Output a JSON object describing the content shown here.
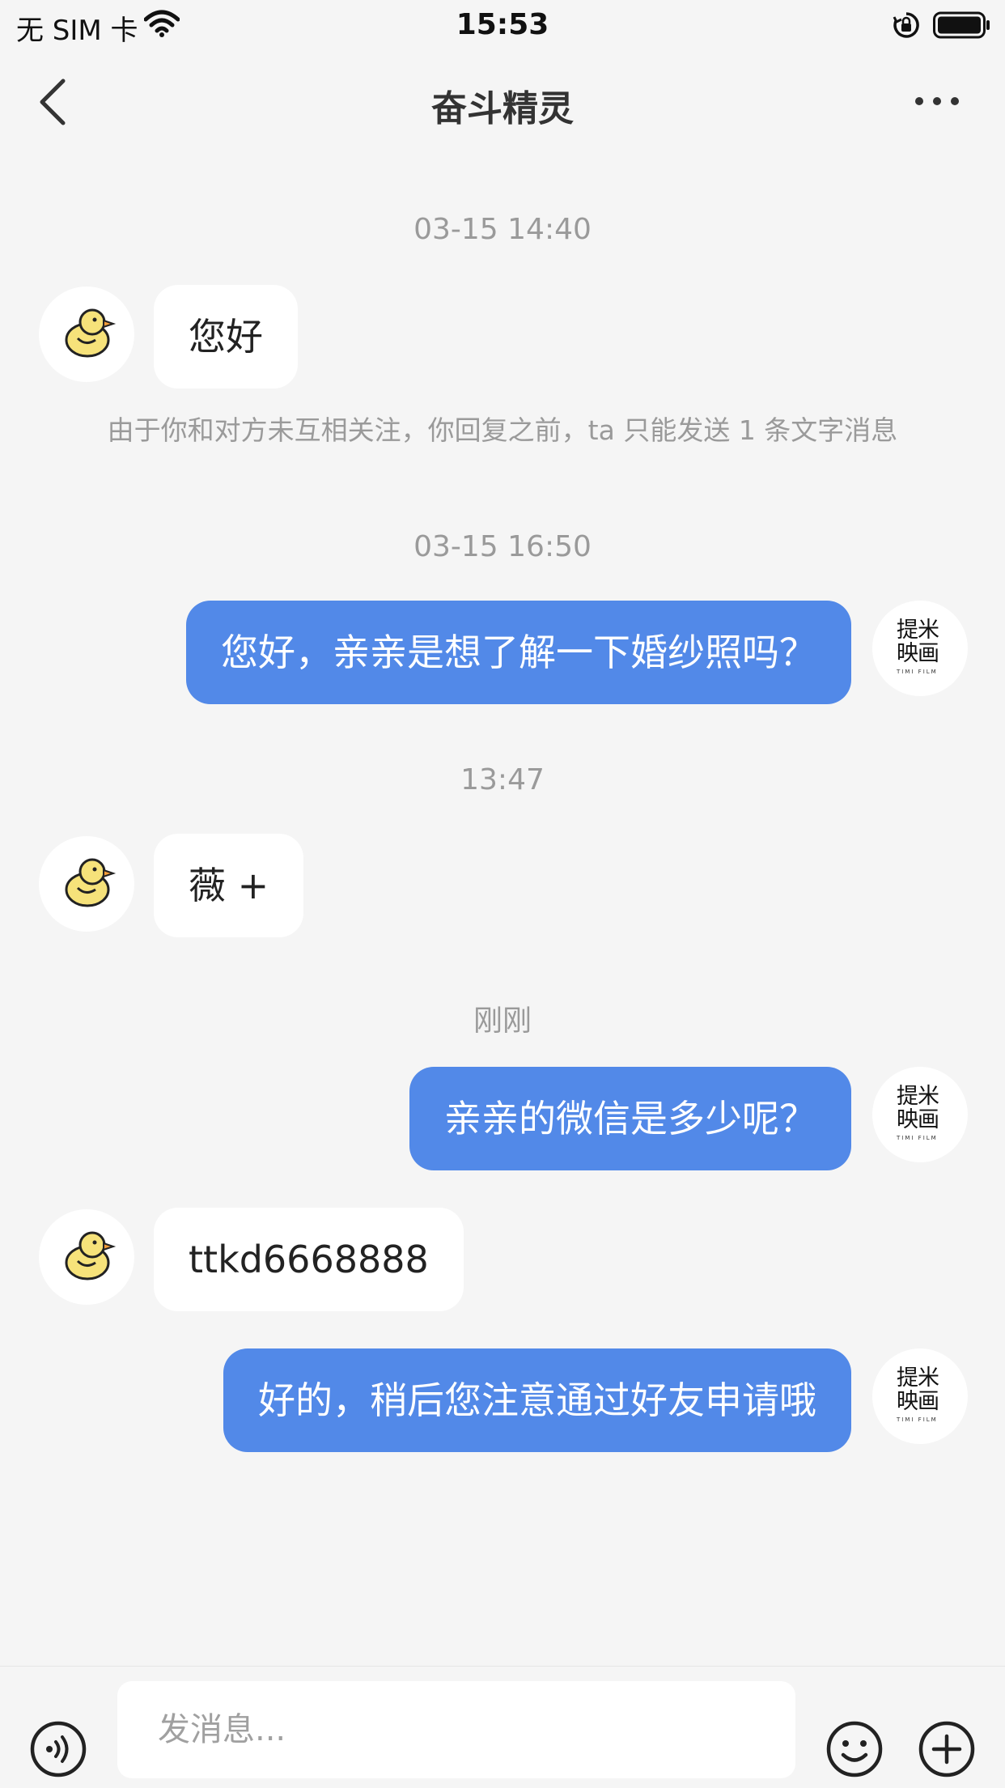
{
  "status_bar": {
    "carrier": "无 SIM 卡",
    "time": "15:53"
  },
  "header": {
    "title": "奋斗精灵"
  },
  "brand_avatar": {
    "line1": "提米",
    "line2": "映画",
    "sub": "TIMI FILM"
  },
  "conversation": [
    {
      "type": "time",
      "text": "03-15 14:40"
    },
    {
      "type": "message",
      "side": "left",
      "text": "您好"
    },
    {
      "type": "notice",
      "text": "由于你和对方未互相关注，你回复之前，ta 只能发送 1 条文字消息"
    },
    {
      "type": "time",
      "text": "03-15 16:50"
    },
    {
      "type": "message",
      "side": "right",
      "text": "您好，亲亲是想了解一下婚纱照吗？"
    },
    {
      "type": "time",
      "text": "13:47"
    },
    {
      "type": "message",
      "side": "left",
      "text": "薇 +"
    },
    {
      "type": "time",
      "text": "刚刚"
    },
    {
      "type": "message",
      "side": "right",
      "text": "亲亲的微信是多少呢？"
    },
    {
      "type": "message",
      "side": "left",
      "text": "ttkd6668888"
    },
    {
      "type": "message",
      "side": "right",
      "text": "好的，稍后您注意通过好友申请哦"
    }
  ],
  "input_bar": {
    "placeholder": "发消息..."
  },
  "icons": {
    "back": "chevron-left-icon",
    "more": "more-dots-icon",
    "voice": "voice-icon",
    "emoji": "emoji-icon",
    "plus": "plus-icon",
    "duck": "duck-avatar-icon"
  },
  "colors": {
    "background": "#f5f5f5",
    "outgoing_bubble": "#5289e8",
    "incoming_bubble": "#ffffff",
    "meta_text": "#9a9a9a",
    "duck_yellow": "#f6e27a"
  }
}
